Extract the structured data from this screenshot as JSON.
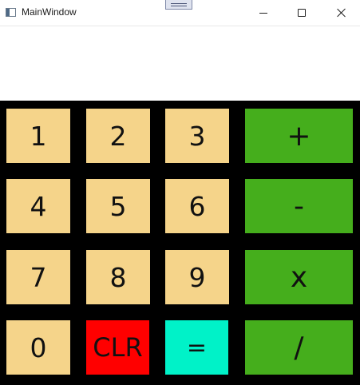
{
  "window": {
    "title": "MainWindow",
    "icon": "app-window-icon"
  },
  "caption_buttons": {
    "minimize": "minimize-icon",
    "maximize": "maximize-icon",
    "close": "close-icon"
  },
  "display": {
    "value": ""
  },
  "keys": {
    "k1": "1",
    "k2": "2",
    "k3": "3",
    "plus": "+",
    "k4": "4",
    "k5": "5",
    "k6": "6",
    "minus": "-",
    "k7": "7",
    "k8": "8",
    "k9": "9",
    "multiply": "x",
    "k0": "0",
    "clear": "CLR",
    "equals": "=",
    "divide": "/"
  },
  "colors": {
    "number_key": "#f5d48a",
    "operator_key": "#45ae1c",
    "clear_key": "#ff0000",
    "equals_key": "#00f2c8",
    "keypad_background": "#000000"
  }
}
